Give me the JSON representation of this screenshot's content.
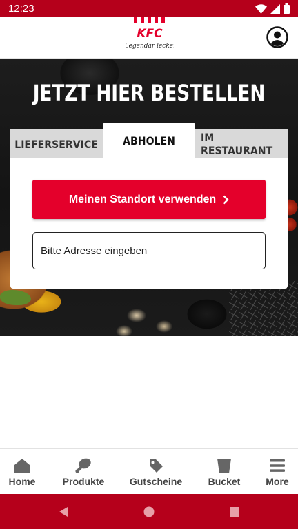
{
  "status_bar": {
    "time": "12:23"
  },
  "header": {
    "logo_text": "KFC",
    "logo_tagline": "Legendär lecker",
    "account_icon": "account-circle-icon"
  },
  "hero": {
    "title": "JETZT HIER BESTELLEN"
  },
  "order_tabs": {
    "delivery": "LIEFERSERVICE",
    "pickup": "ABHOLEN",
    "restaurant": "IM RESTAURANT",
    "active": "pickup"
  },
  "pickup_form": {
    "location_button": "Meinen Standort verwenden",
    "address_placeholder": "Bitte Adresse eingeben",
    "address_value": ""
  },
  "bottom_nav": {
    "items": [
      {
        "label": "Home",
        "icon": "home-icon"
      },
      {
        "label": "Produkte",
        "icon": "drumstick-icon"
      },
      {
        "label": "Gutscheine",
        "icon": "tag-icon"
      },
      {
        "label": "Bucket",
        "icon": "bucket-icon"
      },
      {
        "label": "More",
        "icon": "menu-icon"
      }
    ]
  },
  "colors": {
    "brand_red": "#e4002b",
    "system_bar": "#b5001b",
    "tab_inactive": "#d9d9d9",
    "nav_text": "#444444"
  }
}
